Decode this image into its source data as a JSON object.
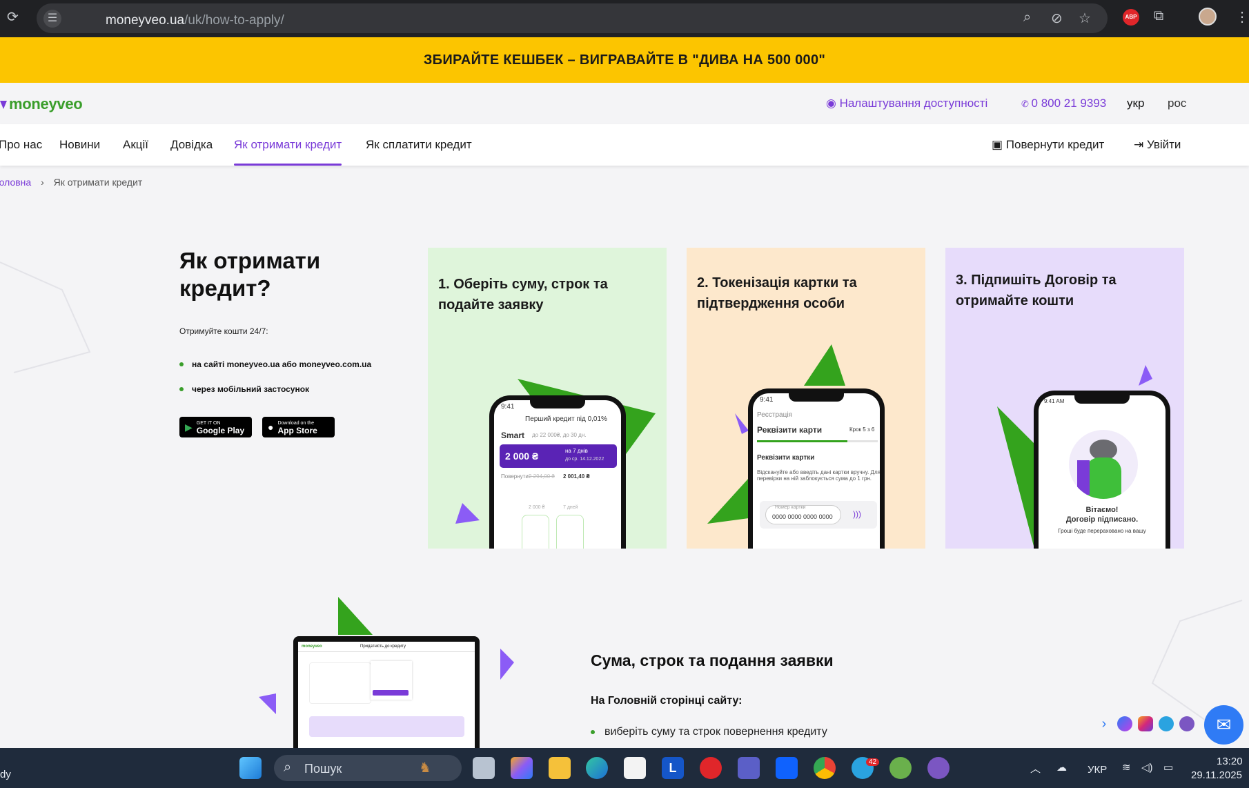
{
  "browser": {
    "url_host": "moneyveo.ua",
    "url_path": "/uk/how-to-apply/",
    "abp_badge": "ABP"
  },
  "promo": {
    "text": "ЗБИРАЙТЕ КЕШБЕК – ВИГРАВАЙТЕ В \"ДИВА НА 500 000\""
  },
  "header": {
    "logo": "moneyveo",
    "accessibility": "Налаштування доступності",
    "phone": "0 800 21 9393",
    "lang_ukr": "укр",
    "lang_ros": "рос"
  },
  "nav": {
    "items": [
      "Про нас",
      "Новини",
      "Акції",
      "Довідка",
      "Як отримати кредит",
      "Як сплатити кредит"
    ],
    "repay": "Повернути кредит",
    "login": "Увійти"
  },
  "breadcrumb": {
    "home": "Головна",
    "current": "Як отримати кредит"
  },
  "hero": {
    "title": "Як отримати кредит?",
    "subtitle": "Отримуйте кошти 24/7:",
    "bullets": [
      "на сайті moneyveo.ua або moneyveo.com.ua",
      "через мобільний застосунок"
    ],
    "google_small": "GET IT ON",
    "google": "Google Play",
    "apple_small": "Download on the",
    "apple": "App Store"
  },
  "cards": [
    {
      "title": "1. Оберіть суму, строк та подайте заявку",
      "bg": "#dff5db",
      "phone": {
        "time": "9:41",
        "banner": "Перший кредит під 0,01%",
        "smart": "Smart",
        "smart_hint": "до 22 000₴, до 30 дн.",
        "amount": "2 000 ₴",
        "days": "на 7 днів",
        "until": "до ср. 14.12.2022",
        "return_label": "Повернути:",
        "old": "2 294,00 ₴",
        "new": "2 001,40 ₴",
        "f1": "2 000 ₴",
        "f2": "7 дней"
      }
    },
    {
      "title": "2. Токенізація картки та підтвердження особи",
      "bg": "#fde8cc",
      "phone": {
        "time": "9:41",
        "reg": "Реєстрація",
        "h": "Реквізити карти",
        "step": "Крок 5 з 6",
        "h2": "Реквізити картки",
        "txt": "Відскануйте або введіть дані картки вручну. Для перевірки на ній заблокується сума до 1 грн.",
        "num_label": "Номер картки",
        "num": "0000 0000 0000 0000"
      }
    },
    {
      "title": "3. Підпишіть Договір та отримайте кошти",
      "bg": "#e7dcfb",
      "phone": {
        "time": "9:41 AM",
        "hello": "Вітаємо!",
        "signed": "Договір підписано.",
        "money": "Гроші буде перераховано на вашу"
      }
    }
  ],
  "section2": {
    "title": "Сума, строк та подання заявки",
    "subtitle": "На Головній сторінці сайту:",
    "bullet": "виберіть суму та строк повернення кредиту",
    "laptop_heading": "Придатність до кредиту"
  },
  "taskbar": {
    "search": "Пошук",
    "left_text": "dy",
    "lang": "УКР",
    "time": "13:20",
    "date": "29.11.2025",
    "telegram_badge": "42"
  }
}
